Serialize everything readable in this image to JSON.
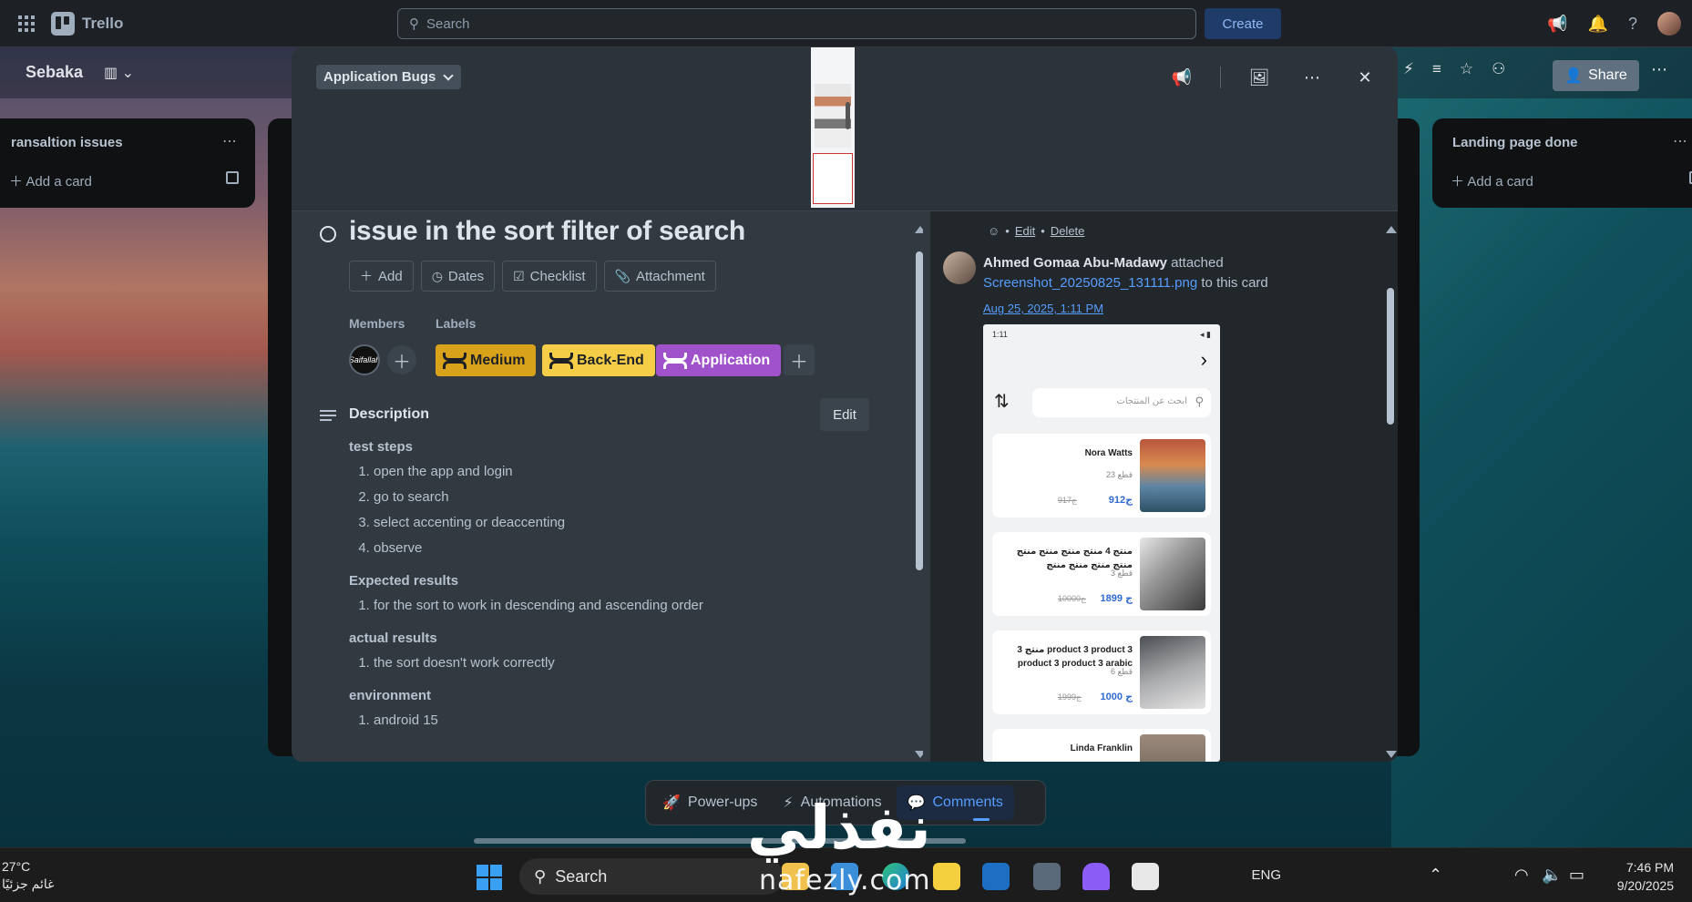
{
  "app": {
    "name": "Trello"
  },
  "topbar": {
    "search_placeholder": "Search",
    "create_label": "Create"
  },
  "board": {
    "title": "Sebaka",
    "share_label": "Share",
    "lists": [
      {
        "title": "ransaltion issues",
        "add_label": "Add a card"
      },
      {
        "title": "Landing page done",
        "add_label": "Add a card"
      }
    ]
  },
  "card": {
    "list_name": "Application Bugs",
    "title": "issue in the sort filter of search",
    "actions": [
      "Add",
      "Dates",
      "Checklist",
      "Attachment"
    ],
    "members_heading": "Members",
    "member_avatar_text": "Saifallah",
    "labels_heading": "Labels",
    "labels": [
      {
        "name": "Medium",
        "bg": "#d9a21b",
        "fg": "#1d2125"
      },
      {
        "name": "Back-End",
        "bg": "#f5cd47",
        "fg": "#1d2125"
      },
      {
        "name": "Application",
        "bg": "#9f52c9",
        "fg": "#ffffff"
      }
    ],
    "description_heading": "Description",
    "edit_label": "Edit",
    "description": {
      "test_steps_heading": "test steps",
      "test_steps": [
        "open the app and login",
        "go to search",
        "select accenting or deaccenting",
        "observe"
      ],
      "expected_heading": "Expected results",
      "expected": [
        "for the sort to work in descending and ascending order"
      ],
      "actual_heading": "actual results",
      "actual": [
        "the sort doesn't work correctly"
      ],
      "environment_heading": "environment",
      "environment": [
        "android 15"
      ]
    }
  },
  "activity": {
    "top_edit": "Edit",
    "top_delete": "Delete",
    "author": "Ahmed Gomaa Abu-Madawy",
    "verb": "attached",
    "file": "Screenshot_20250825_131111.png",
    "suffix": "to this card",
    "date": "Aug 25, 2025, 1:11 PM",
    "screenshot": {
      "time": "1:11",
      "search_placeholder": "ابحث عن المنتجات",
      "products": [
        {
          "name": "Nora Watts",
          "cat": "23 قطع",
          "price": "912ج",
          "old": "917ج"
        },
        {
          "name": "منتج 4 منتج منتج منتج منتج منتج منتج منتج منتج",
          "cat": "3 قطع",
          "price": "1899 ج",
          "old": "10000ج"
        },
        {
          "name": "منتج 3 product 3 product 3 product 3 product 3 arabic",
          "cat": "6 قطع",
          "price": "1000 ج",
          "old": "1999ج"
        },
        {
          "name": "Linda Franklin",
          "cat": "",
          "price": "",
          "old": ""
        }
      ]
    }
  },
  "bottom_nav": {
    "powerups": "Power-ups",
    "automations": "Automations",
    "comments": "Comments"
  },
  "watermark": {
    "arabic": "نفذلي",
    "latin": "nafezly.com"
  },
  "taskbar": {
    "temperature": "27°C",
    "weather": "غائم جزئيًا",
    "search_label": "Search",
    "language": "ENG",
    "time": "7:46 PM",
    "date": "9/20/2025"
  }
}
